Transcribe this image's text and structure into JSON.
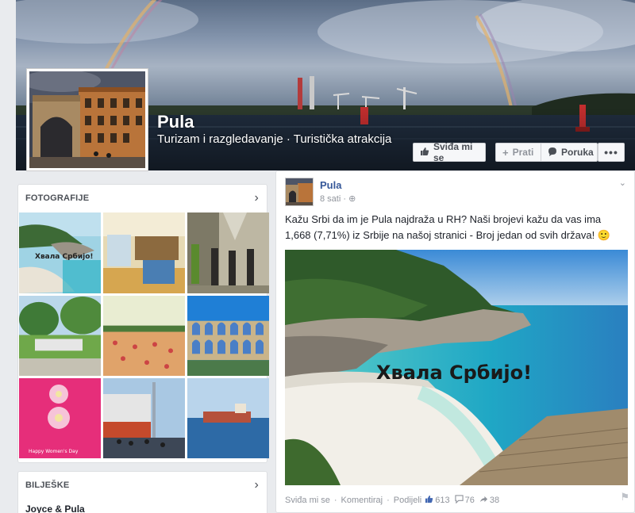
{
  "page": {
    "name": "Pula",
    "category": "Turizam i razgledavanje · Turistička atrakcija"
  },
  "actions": {
    "like": "Sviđa mi se",
    "follow": "Prati",
    "message": "Poruka",
    "more": "•••"
  },
  "sidebar": {
    "photos_title": "FOTOGRAFIJE",
    "photo_caption_1": "Хвала Србијо!",
    "photo_caption_7": "Happy Women's Day",
    "notes_title": "BILJEŠKE",
    "notes_item": "Joyce & Pula"
  },
  "post": {
    "author": "Pula",
    "time": "8 sati",
    "text": "Kažu Srbi da im je Pula najdraža u RH? Naši brojevi kažu da vas ima 1,668 (7,71%) iz Srbije na našoj stranici - Broj jedan od svih država! 🙂",
    "image_caption": "Хвала Србијо!",
    "footer": {
      "like": "Sviđa mi se",
      "comment": "Komentiraj",
      "share": "Podijeli",
      "likes": "613",
      "comments": "76",
      "shares": "38"
    }
  },
  "colors": {
    "link": "#365899",
    "meta": "#90949c",
    "background": "#e9ebee"
  }
}
